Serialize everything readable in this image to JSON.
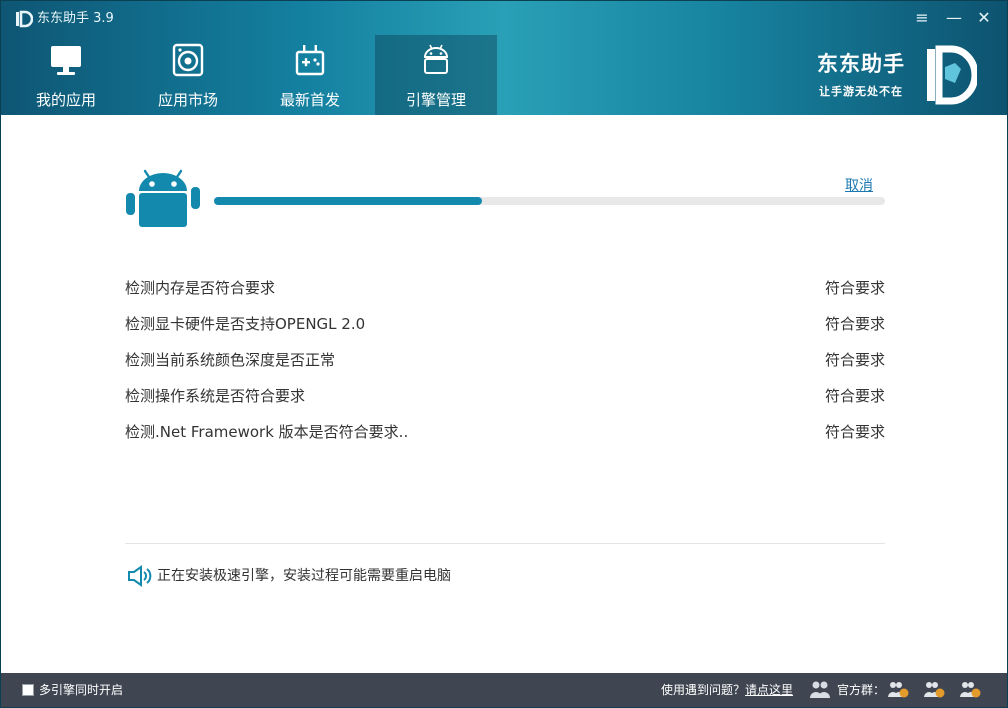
{
  "window": {
    "app_title": "东东助手 3.9",
    "menu_glyph": "≡",
    "min_glyph": "—",
    "close_glyph": "✕"
  },
  "nav": {
    "tabs": [
      {
        "label": "我的应用",
        "icon": "monitor-icon"
      },
      {
        "label": "应用市场",
        "icon": "store-camera-icon"
      },
      {
        "label": "最新首发",
        "icon": "gamepad-icon"
      },
      {
        "label": "引擎管理",
        "icon": "android-icon",
        "active": true
      }
    ]
  },
  "brand": {
    "name": "东东助手",
    "slogan": "让手游无处不在"
  },
  "install": {
    "cancel_label": "取消",
    "progress": 0.4,
    "checks": [
      {
        "label": "检测内存是否符合要求",
        "status": "符合要求"
      },
      {
        "label": "检测显卡硬件是否支持OPENGL 2.0",
        "status": "符合要求"
      },
      {
        "label": "检测当前系统颜色深度是否正常",
        "status": "符合要求"
      },
      {
        "label": "检测操作系统是否符合要求",
        "status": "符合要求"
      },
      {
        "label": "检测.Net Framework 版本是否符合要求..",
        "status": "符合要求"
      }
    ],
    "notice": "正在安装极速引擎，安装过程可能需要重启电脑"
  },
  "footer": {
    "multi_engine_label": "多引擎同时开启",
    "multi_engine_checked": false,
    "help_prefix": "使用遇到问题？",
    "help_link": "请点这里",
    "group_label": "官方群："
  },
  "colors": {
    "accent": "#1289ad",
    "link": "#1b78b0",
    "footer_bg": "#3f4651"
  }
}
